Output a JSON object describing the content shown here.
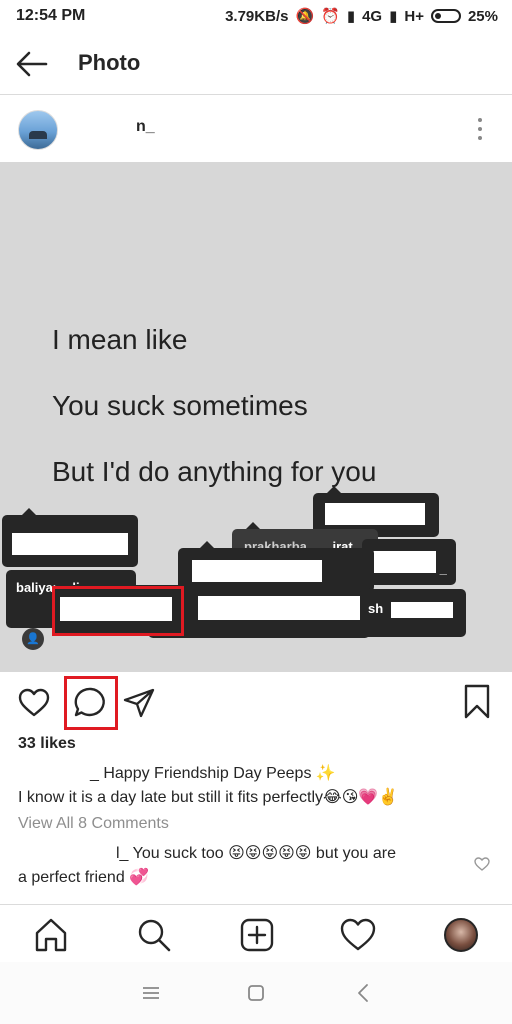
{
  "status": {
    "time": "12:54 PM",
    "speed": "3.79KB/s",
    "network": "4G",
    "network2": "H+",
    "battery": "25%"
  },
  "header": {
    "title": "Photo"
  },
  "post": {
    "username": "n_",
    "photo_lines": [
      "I mean like",
      "You suck sometimes",
      "But I'd do anything for you"
    ],
    "tags": {
      "baliyan": "baliyan_div",
      "prakhar": "prakharba",
      "irat": "irat",
      "under": "_",
      "sh": "sh"
    },
    "likes": "33 likes",
    "caption_line1": "_ Happy Friendship Day Peeps ✨",
    "caption_line2": "I know it is a day late but still it fits perfectly😂😘💗✌️",
    "view_all": "View All 8 Comments",
    "comment_line1": "l_ You suck too 😝😝😝😝😝 but you are",
    "comment_line2": "a perfect friend 💞"
  },
  "icons": {
    "back": "arrow-left-icon",
    "more": "more-vertical-icon",
    "like": "heart-icon",
    "comment": "comment-icon",
    "share": "send-icon",
    "save": "bookmark-icon",
    "home": "home-icon",
    "search": "search-icon",
    "add": "add-post-icon",
    "activity": "heart-icon",
    "profile": "avatar"
  },
  "colors": {
    "highlight": "#e01a22",
    "tag_bg": "#262626",
    "photo_bg": "#d7d7d7"
  }
}
